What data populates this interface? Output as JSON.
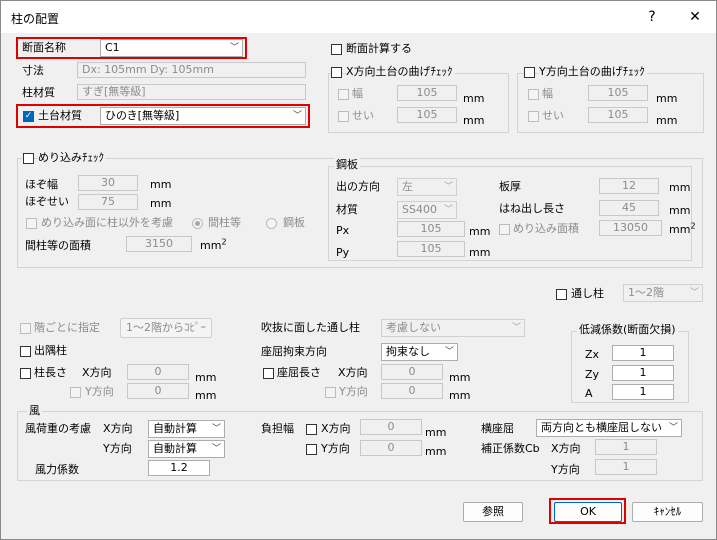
{
  "window": {
    "title": "柱の配置",
    "help": "?",
    "close": "✕"
  },
  "section": {
    "label": "断面名称",
    "value": "C1",
    "size_label": "寸法",
    "size_value": "Dx: 105mm  Dy: 105mm",
    "material_label": "柱材質",
    "material_value": "すぎ[無等級]",
    "sill_label": "土台材質",
    "sill_value": "ひのき[無等級]"
  },
  "calc": {
    "label": "断面計算する"
  },
  "xcheck": {
    "label": "X方向土台の曲げﾁｪｯｸ",
    "width_label": "幅",
    "width_value": "105",
    "height_label": "せい",
    "height_value": "105",
    "unit": "mm"
  },
  "ycheck": {
    "label": "Y方向土台の曲げﾁｪｯｸ",
    "width_label": "幅",
    "width_value": "105",
    "height_label": "せい",
    "height_value": "105",
    "unit": "mm"
  },
  "embed": {
    "label": "めり込みﾁｪｯｸ",
    "tenon_w_label": "ほぞ幅",
    "tenon_w_value": "30",
    "tenon_h_label": "ほぞせい",
    "tenon_h_value": "75",
    "unit": "mm",
    "other_label": "めり込み面に柱以外を考慮",
    "radio1": "間柱等",
    "radio2": "鋼板",
    "area_label": "間柱等の面積",
    "area_value": "3150",
    "area_unit": "mm",
    "area_sup": "2"
  },
  "steel": {
    "title": "鋼板",
    "dir_label": "出の方向",
    "dir_value": "左",
    "thick_label": "板厚",
    "thick_value": "12",
    "mat_label": "材質",
    "mat_value": "SS400",
    "proj_label": "はね出し長さ",
    "proj_value": "45",
    "px_label": "Px",
    "px_value": "105",
    "area_label": "めり込み面積",
    "area_value": "13050",
    "area_unit": "mm",
    "area_sup": "2",
    "py_label": "Py",
    "py_value": "105",
    "unit": "mm"
  },
  "through": {
    "label": "通し柱",
    "value": "1～2階"
  },
  "floor": {
    "label": "階ごとに指定",
    "copy_button": "1～2階からｺﾋﾟｰ"
  },
  "atrium": {
    "label": "吹抜に面した通し柱",
    "value": "考慮しない"
  },
  "reduction": {
    "title": "低減係数(断面欠損)",
    "zx_label": "Zx",
    "zx_value": "1",
    "zy_label": "Zy",
    "zy_value": "1",
    "a_label": "A",
    "a_value": "1"
  },
  "corner": {
    "label": "出隅柱"
  },
  "buckling_dir": {
    "label": "座屈拘束方向",
    "value": "拘束なし"
  },
  "column_len": {
    "label": "柱長さ",
    "x_label": "X方向",
    "x_value": "0",
    "y_label": "Y方向",
    "y_value": "0",
    "unit": "mm"
  },
  "buckling_len": {
    "label": "座屈長さ",
    "x_label": "X方向",
    "x_value": "0",
    "y_label": "Y方向",
    "y_value": "0",
    "unit": "mm"
  },
  "wind": {
    "title": "風",
    "consider_label": "風荷重の考慮",
    "x_label": "X方向",
    "x_value": "自動計算",
    "y_label": "Y方向",
    "y_value": "自動計算",
    "coef_label": "風力係数",
    "coef_value": "1.2",
    "share_label": "負担幅",
    "share_x_label": "X方向",
    "share_x_value": "0",
    "share_y_label": "Y方向",
    "share_y_value": "0",
    "unit": "mm",
    "lateral_label": "横座屈",
    "lateral_value": "両方向とも横座屈しない",
    "corr_label": "補正係数Cb",
    "corr_x_label": "X方向",
    "corr_x_value": "1",
    "corr_y_label": "Y方向",
    "corr_y_value": "1"
  },
  "buttons": {
    "ref": "参照",
    "ok": "OK",
    "cancel": "ｷｬﾝｾﾙ"
  }
}
